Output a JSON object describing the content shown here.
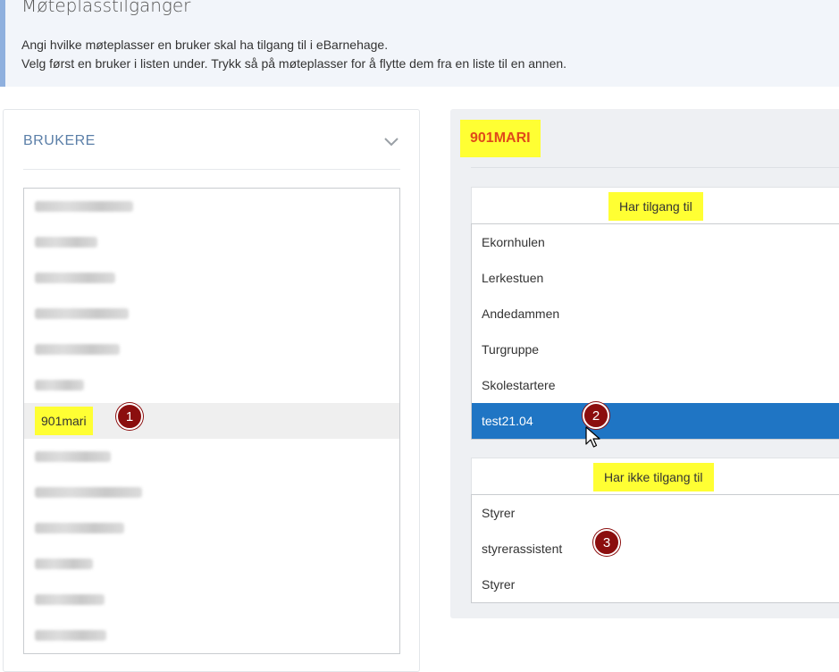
{
  "banner": {
    "title": "Møteplasstilganger",
    "line1": "Angi hvilke møteplasser en bruker skal ha tilgang til i eBarnehage.",
    "line2": "Velg først en bruker i listen under. Trykk så på møteplasser for å flytte dem fra en liste til en annen."
  },
  "users": {
    "header": "BRUKERE",
    "items": [
      {
        "label": "",
        "blurred": true
      },
      {
        "label": "",
        "blurred": true
      },
      {
        "label": "",
        "blurred": true
      },
      {
        "label": "",
        "blurred": true
      },
      {
        "label": "",
        "blurred": true
      },
      {
        "label": "",
        "blurred": true
      },
      {
        "label": "901mari",
        "blurred": false,
        "selected": true
      },
      {
        "label": "",
        "blurred": true
      },
      {
        "label": "",
        "blurred": true
      },
      {
        "label": "",
        "blurred": true
      },
      {
        "label": "",
        "blurred": true
      },
      {
        "label": "",
        "blurred": true
      },
      {
        "label": "",
        "blurred": true
      }
    ]
  },
  "selected_user": "901MARI",
  "has_access": {
    "header": "Har tilgang til",
    "items": [
      "Ekornhulen",
      "Lerkestuen",
      "Andedammen",
      "Turgruppe",
      "Skolestartere",
      "test21.04"
    ],
    "selected": "test21.04"
  },
  "no_access": {
    "header": "Har ikke tilgang til",
    "items": [
      "Styrer",
      "styrerassistent",
      "Styrer"
    ]
  },
  "markers": [
    "1",
    "2",
    "3"
  ],
  "colors": {
    "highlight": "#ffff33",
    "selected_row": "#1f75c4",
    "marker": "#8b0e0e",
    "user_title": "#e04a1a",
    "accent_border": "#8fb0de"
  }
}
